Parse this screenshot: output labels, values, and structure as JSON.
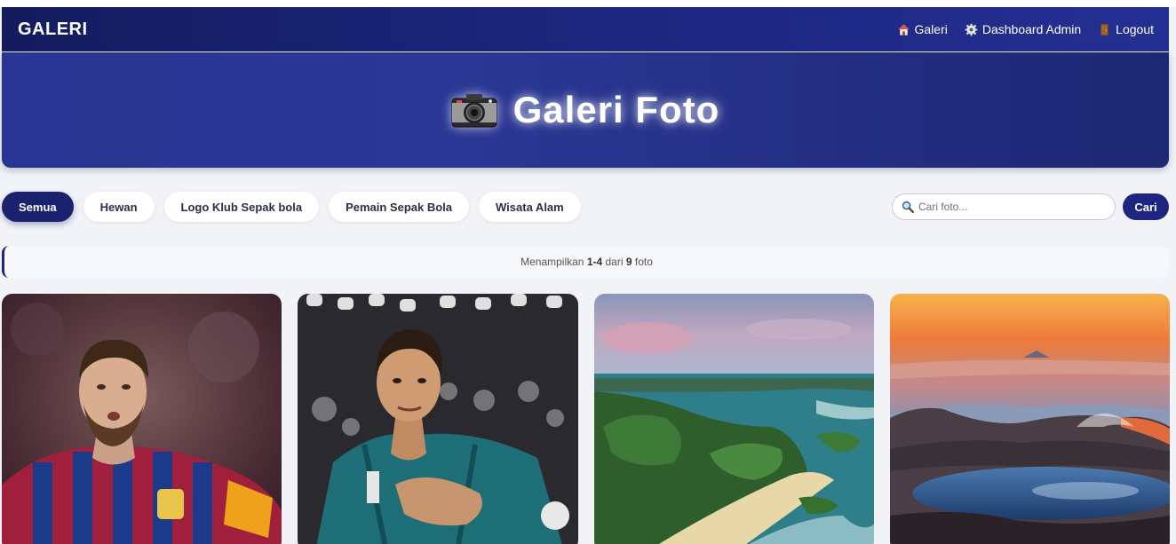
{
  "navbar": {
    "brand": "GALERI",
    "links": [
      {
        "label": "Galeri",
        "icon": "house-icon"
      },
      {
        "label": "Dashboard Admin",
        "icon": "gear-icon"
      },
      {
        "label": "Logout",
        "icon": "door-icon"
      }
    ]
  },
  "hero": {
    "title": "Galeri Foto",
    "icon": "camera-icon"
  },
  "filters": {
    "chips": [
      "Semua",
      "Hewan",
      "Logo Klub Sepak bola",
      "Pemain Sepak Bola",
      "Wisata Alam"
    ],
    "active": "Semua"
  },
  "search": {
    "placeholder": "Cari foto...",
    "value": "",
    "button": "Cari"
  },
  "info": {
    "prefix": "Menampilkan",
    "range": "1-4",
    "middle": "dari",
    "total": "9",
    "suffix": "foto"
  },
  "photos": [
    {
      "subject": "football-player-barcelona-photo"
    },
    {
      "subject": "football-player-madrid-photo"
    },
    {
      "subject": "coastal-islands-landscape-photo"
    },
    {
      "subject": "volcano-crater-lake-sunrise-photo"
    }
  ],
  "colors": {
    "primary": "#1d2580",
    "navbar": "#1a2270",
    "background": "#f2f3f7"
  }
}
